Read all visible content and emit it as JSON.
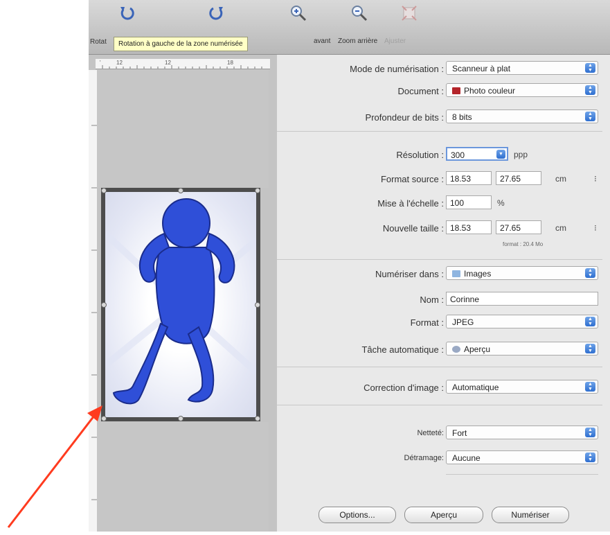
{
  "toolbar": {
    "rotate_left": "Rotat",
    "zoom_in": "ant",
    "zoom_in_full": "avant",
    "zoom_out": "Zoom arrière",
    "fit": "Ajuster",
    "tooltip": "Rotation à gauche de la zone numérisée"
  },
  "ruler": {
    "t1": "12",
    "t2": "12",
    "t3": "18"
  },
  "settings": {
    "scan_mode": {
      "label": "Mode de numérisation :",
      "value": "Scanneur à plat"
    },
    "document": {
      "label": "Document :",
      "value": "Photo couleur"
    },
    "bit_depth": {
      "label": "Profondeur de bits :",
      "value": "8 bits"
    },
    "resolution": {
      "label": "Résolution :",
      "value": "300",
      "unit": "ppp"
    },
    "source_size": {
      "label": "Format source :",
      "width": "18.53",
      "height": "27.65",
      "unit": "cm"
    },
    "scale": {
      "label": "Mise à l'échelle :",
      "value": "100",
      "unit": "%"
    },
    "new_size": {
      "label": "Nouvelle taille :",
      "width": "18.53",
      "height": "27.65",
      "unit": "cm"
    },
    "file_size_note": "format : 20.4 Mo",
    "scan_to": {
      "label": "Numériser dans :",
      "value": "Images"
    },
    "name": {
      "label": "Nom :",
      "value": "Corinne"
    },
    "format": {
      "label": "Format :",
      "value": "JPEG"
    },
    "auto_task": {
      "label": "Tâche automatique :",
      "value": "Aperçu"
    },
    "image_correction": {
      "label": "Correction d'image :",
      "value": "Automatique"
    },
    "sharpness": {
      "label": "Netteté:",
      "value": "Fort"
    },
    "descreen": {
      "label": "Détramage:",
      "value": "Aucune"
    }
  },
  "buttons": {
    "options": "Options...",
    "preview": "Aperçu",
    "scan": "Numériser"
  },
  "colors": {
    "accent": "#2f6fd0",
    "figure": "#2f4fd8",
    "arrow": "#ff3b1f"
  }
}
